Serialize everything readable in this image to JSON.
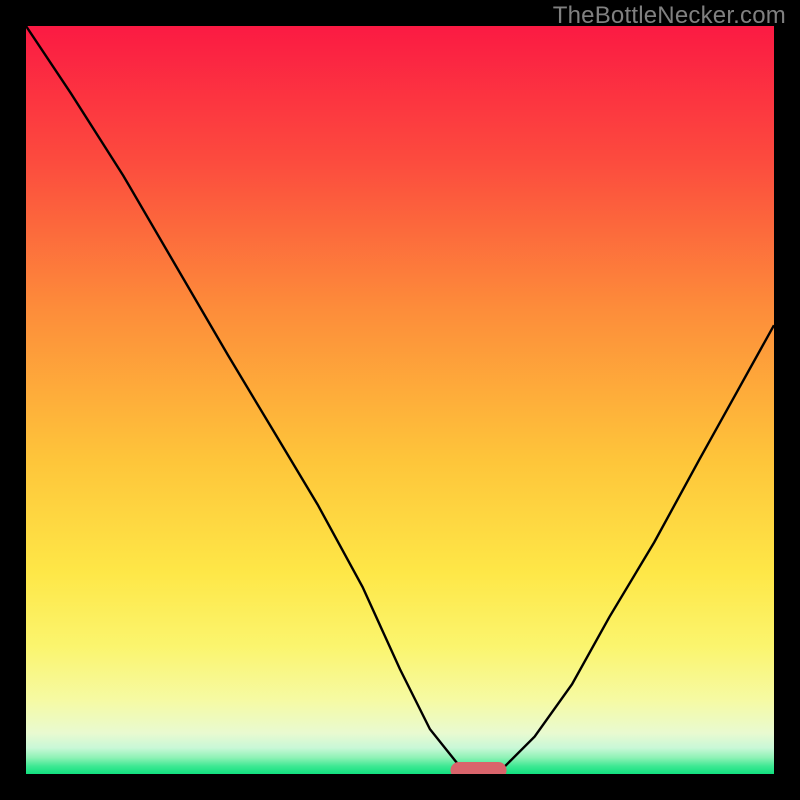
{
  "watermark": "TheBottleNecker.com",
  "chart_data": {
    "type": "line",
    "title": "",
    "xlabel": "",
    "ylabel": "",
    "xlim": [
      0,
      100
    ],
    "ylim": [
      0,
      100
    ],
    "curve_points": [
      [
        0,
        100
      ],
      [
        6,
        91
      ],
      [
        13,
        80
      ],
      [
        20,
        68
      ],
      [
        27,
        56
      ],
      [
        33,
        46
      ],
      [
        39,
        36
      ],
      [
        45,
        25
      ],
      [
        50,
        14
      ],
      [
        54,
        6
      ],
      [
        58,
        1
      ],
      [
        60,
        0
      ],
      [
        62,
        0
      ],
      [
        64,
        1
      ],
      [
        68,
        5
      ],
      [
        73,
        12
      ],
      [
        78,
        21
      ],
      [
        84,
        31
      ],
      [
        90,
        42
      ],
      [
        95,
        51
      ],
      [
        100,
        60
      ]
    ],
    "marker": {
      "x_center": 60.5,
      "y": 0.5,
      "width": 7.5,
      "height": 2.2,
      "color": "#d9646b"
    },
    "gradient_stops": [
      {
        "offset": 0.0,
        "color": "#fb1a43"
      },
      {
        "offset": 0.18,
        "color": "#fc4b3e"
      },
      {
        "offset": 0.38,
        "color": "#fd8d3a"
      },
      {
        "offset": 0.58,
        "color": "#fec53a"
      },
      {
        "offset": 0.73,
        "color": "#fee747"
      },
      {
        "offset": 0.83,
        "color": "#fbf56e"
      },
      {
        "offset": 0.9,
        "color": "#f6faa2"
      },
      {
        "offset": 0.945,
        "color": "#e9fad0"
      },
      {
        "offset": 0.965,
        "color": "#c9f8d7"
      },
      {
        "offset": 0.978,
        "color": "#8ff2b6"
      },
      {
        "offset": 0.99,
        "color": "#3be892"
      },
      {
        "offset": 1.0,
        "color": "#11e07e"
      }
    ]
  }
}
